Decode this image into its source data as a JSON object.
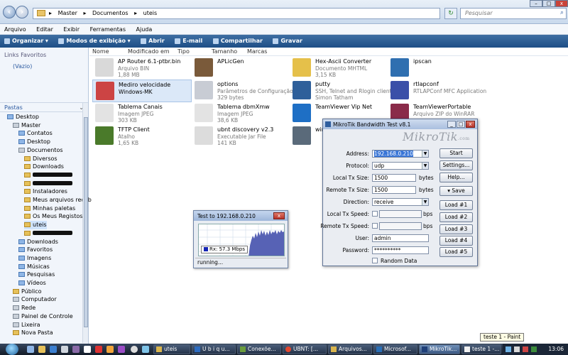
{
  "explorer": {
    "breadcrumb": [
      "Master",
      "Documentos",
      "uteis"
    ],
    "search_placeholder": "Pesquisar",
    "menu": [
      "Arquivo",
      "Editar",
      "Exibir",
      "Ferramentas",
      "Ajuda"
    ],
    "toolbar": [
      "Organizar",
      "Modos de exibição",
      "Abrir",
      "E-mail",
      "Compartilhar",
      "Gravar"
    ],
    "columns": [
      "Nome",
      "Modificado em",
      "Tipo",
      "Tamanho",
      "Marcas"
    ],
    "links_header": "Links Favoritos",
    "links_empty": "(Vazio)",
    "folders_header": "Pastas",
    "tree": [
      {
        "label": "Desktop",
        "icon": "blue"
      },
      {
        "label": "Master",
        "icon": "gray"
      },
      {
        "label": "Contatos",
        "icon": "blue"
      },
      {
        "label": "Desktop",
        "icon": "blue"
      },
      {
        "label": "Documentos",
        "icon": "gray"
      },
      {
        "label": "Diversos",
        "icon": "yellow"
      },
      {
        "label": "Downloads",
        "icon": "yellow"
      },
      {
        "label": "",
        "icon": "yellow"
      },
      {
        "label": "",
        "icon": "yellow"
      },
      {
        "label": "Instaladores",
        "icon": "yellow"
      },
      {
        "label": "Meus arquivos receb",
        "icon": "yellow"
      },
      {
        "label": "Minhas paletas",
        "icon": "yellow"
      },
      {
        "label": "Os Meus Registos",
        "icon": "yellow"
      },
      {
        "label": "uteis",
        "icon": "yellow"
      },
      {
        "label": "",
        "icon": "yellow"
      },
      {
        "label": "Downloads",
        "icon": "blue"
      },
      {
        "label": "Favoritos",
        "icon": "blue"
      },
      {
        "label": "Imagens",
        "icon": "blue"
      },
      {
        "label": "Músicas",
        "icon": "blue"
      },
      {
        "label": "Pesquisas",
        "icon": "blue"
      },
      {
        "label": "Vídeos",
        "icon": "blue"
      },
      {
        "label": "Público",
        "icon": "yellow"
      },
      {
        "label": "Computador",
        "icon": "gray"
      },
      {
        "label": "Rede",
        "icon": "gray"
      },
      {
        "label": "Painel de Controle",
        "icon": "gray"
      },
      {
        "label": "Lixeira",
        "icon": "gray"
      },
      {
        "label": "Nova Pasta",
        "icon": "yellow"
      }
    ],
    "files": [
      {
        "name": "AP Router 6.1-ptbr.bin",
        "type": "Arquivo BIN",
        "size": "1,88 MB",
        "color": "#d9d9d9"
      },
      {
        "name": "APLicGen",
        "type": "",
        "size": "",
        "color": "#7a5a3a"
      },
      {
        "name": "Hex-Ascii Converter",
        "type": "Documento MHTML",
        "size": "3,15 KB",
        "color": "#e5c04a"
      },
      {
        "name": "ipscan",
        "type": "",
        "size": "",
        "color": "#2f6fb0"
      },
      {
        "name": "Medirо velocidade",
        "type": "Windows-MK",
        "size": "",
        "color": "#c44"
      },
      {
        "name": "options",
        "type": "Parâmetros de Configuração",
        "size": "329 bytes",
        "color": "#c8ccd4"
      },
      {
        "name": "putty",
        "type": "SSH, Telnet and Rlogin client",
        "size": "Simon Tatham",
        "color": "#2e5f9a"
      },
      {
        "name": "rtlapconf",
        "type": "RTLAPConf MFC Application",
        "size": "",
        "color": "#3a4fa8"
      },
      {
        "name": "Tablema Canais",
        "type": "Imagem JPEG",
        "size": "303 KB",
        "color": "#e3e3e3"
      },
      {
        "name": "Tablema dbmXmw",
        "type": "Imagem JPEG",
        "size": "38,6 KB",
        "color": "#e3e3e3"
      },
      {
        "name": "TeamViewer Vip Net",
        "type": "",
        "size": "",
        "color": "#1e6fc5"
      },
      {
        "name": "TeamViewerPortable",
        "type": "Arquivo ZIP do WinRAR",
        "size": "",
        "color": "#8a2b4a"
      },
      {
        "name": "TFTP Client",
        "type": "Atalho",
        "size": "1,65 KB",
        "color": "#4a7a2a"
      },
      {
        "name": "ubnt discovery v2.3",
        "type": "Executable Jar File",
        "size": "141 KB",
        "color": "#dcdcdc"
      },
      {
        "name": "win",
        "type": "",
        "size": "",
        "color": "#5a6a7a"
      }
    ]
  },
  "test_window": {
    "title": "Test to 192.168.0.210",
    "legend": "Rx: 57.3 Mbps",
    "status": "running...",
    "rx_mbps": 57.3
  },
  "mikrotik": {
    "title": "MikroTik Bandwidth Test v8.1",
    "logo": "MikroTik",
    "logo_suffix": ".com",
    "labels": {
      "address": "Address:",
      "protocol": "Protocol:",
      "local_tx_size": "Local Tx Size:",
      "remote_tx_size": "Remote Tx Size:",
      "direction": "Direction:",
      "local_tx_speed": "Local Tx Speed:",
      "remote_tx_speed": "Remote Tx Speed:",
      "user": "User:",
      "password": "Password:",
      "random_data": "Random Data",
      "bytes": "bytes",
      "bps": "bps"
    },
    "values": {
      "address": "192.168.0.210",
      "protocol": "udp",
      "local_tx_size": "1500",
      "remote_tx_size": "1500",
      "direction": "receive",
      "user": "admin",
      "password": "**********"
    },
    "buttons": [
      "Start",
      "Settings...",
      "Help...",
      "▾ Save",
      "Load #1",
      "Load #2",
      "Load #3",
      "Load #4",
      "Load #5"
    ]
  },
  "taskbar": {
    "tasks": [
      "uteis",
      "U b i q u...",
      "Conexõe...",
      "UBNT: [...",
      "Arquivos...",
      "Microsof...",
      "MikroTik...",
      "teste 1 -..."
    ],
    "clock": "13:06",
    "tooltip": "teste 1 - Paint"
  }
}
